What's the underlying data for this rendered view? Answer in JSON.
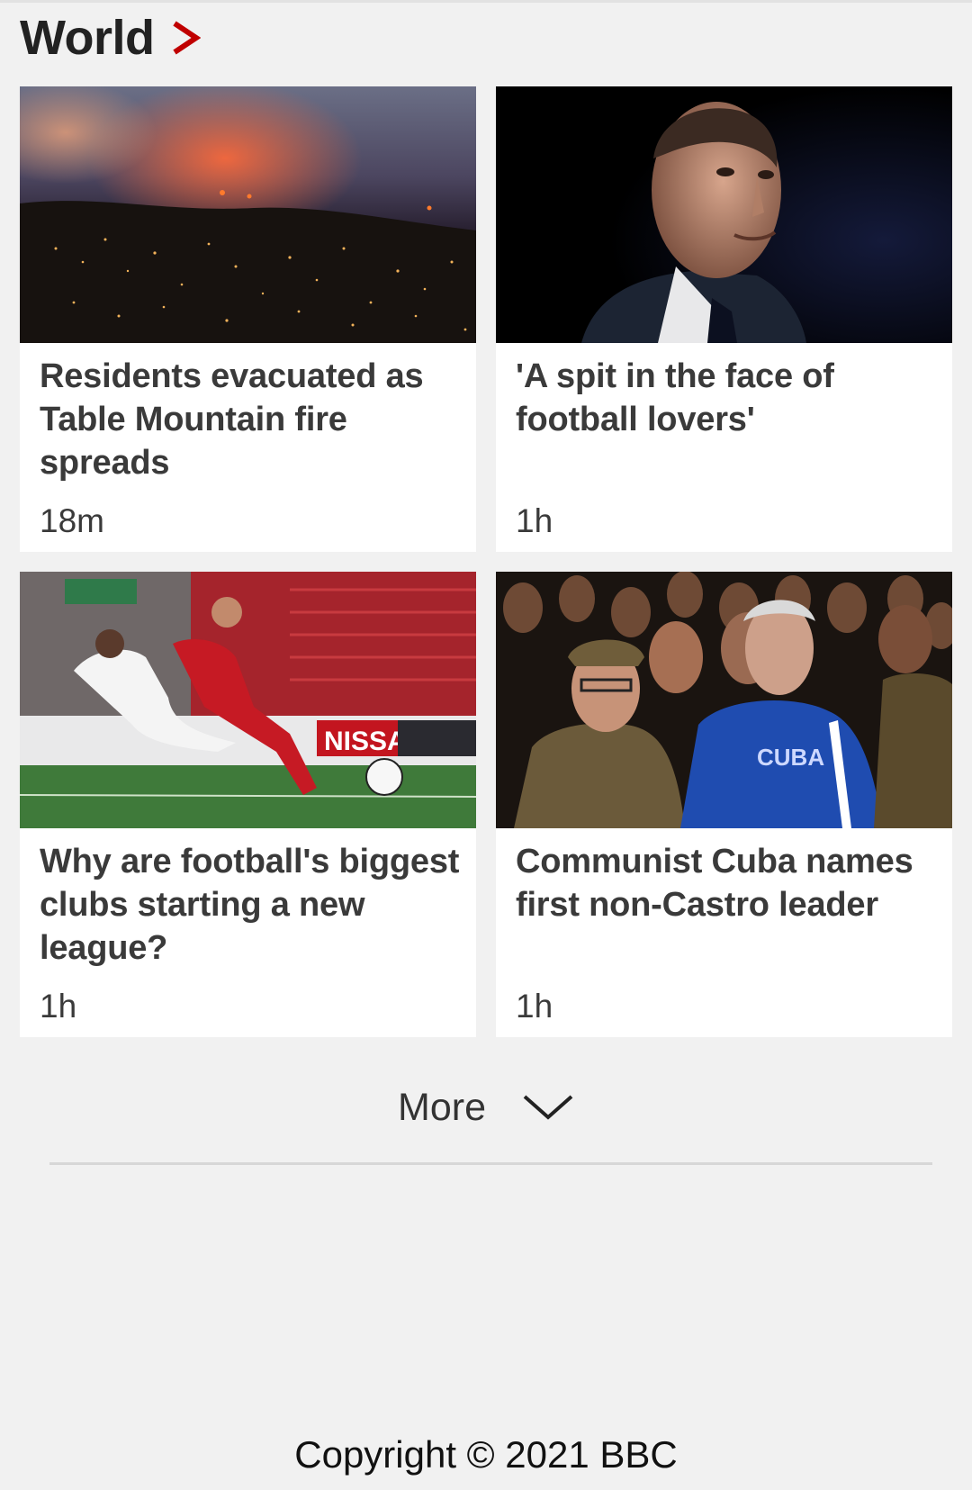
{
  "section": {
    "title": "World",
    "accent_color": "#c00000",
    "chevron_icon": "chevron-right-icon"
  },
  "articles": [
    {
      "headline": "Residents evacuated as Table Mountain fire spreads",
      "time": "18m",
      "image": "wildfire-city-night-photo"
    },
    {
      "headline": "'A spit in the face of football lovers'",
      "time": "1h",
      "image": "official-portrait-photo"
    },
    {
      "headline": "Why are football's biggest clubs starting a new league?",
      "time": "1h",
      "image": "football-match-tackle-photo"
    },
    {
      "headline": "Communist Cuba names first non-Castro leader",
      "time": "1h",
      "image": "cuban-leaders-crowd-photo"
    }
  ],
  "more": {
    "label": "More",
    "icon": "chevron-down-icon"
  },
  "footer": {
    "copyright": "Copyright © 2021 BBC"
  }
}
